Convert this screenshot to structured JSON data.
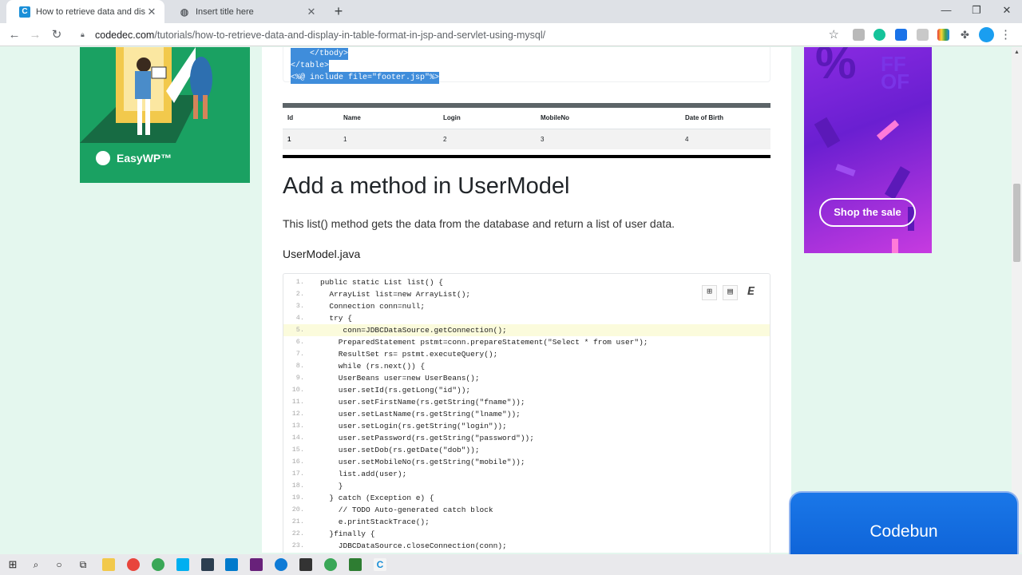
{
  "browser": {
    "tabs": [
      {
        "title": "How to retrieve data and display",
        "active": true,
        "favicon": "C"
      },
      {
        "title": "Insert title here",
        "active": false,
        "favicon": "globe-icon"
      }
    ],
    "url_host": "codedec.com",
    "url_path": "/tutorials/how-to-retrieve-data-and-display-in-table-format-in-jsp-and-servlet-using-mysql/"
  },
  "code_top": [
    "    </tbody>",
    "</table>",
    "<%@ include file=\"footer.jsp\"%>"
  ],
  "example_table": {
    "headers": [
      "Id",
      "Name",
      "Login",
      "MobileNo",
      "Date of Birth"
    ],
    "row": [
      "1",
      "1",
      "2",
      "3",
      "4"
    ]
  },
  "heading": "Add a method in UserModel",
  "paragraph": "This list() method gets the data from the database and return a list of user data.",
  "filename": "UserModel.java",
  "code_lines": [
    {
      "n": "1.",
      "text": "public static List list() {"
    },
    {
      "n": "2.",
      "text": "  ArrayList list=new ArrayList();"
    },
    {
      "n": "3.",
      "text": "  Connection conn=null;"
    },
    {
      "n": "4.",
      "text": "  try {"
    },
    {
      "n": "5.",
      "text": "     conn=JDBCDataSource.getConnection();"
    },
    {
      "n": "6.",
      "text": "    PreparedStatement pstmt=conn.prepareStatement(\"Select * from user\");"
    },
    {
      "n": "7.",
      "text": "    ResultSet rs= pstmt.executeQuery();"
    },
    {
      "n": "8.",
      "text": "    while (rs.next()) {"
    },
    {
      "n": "9.",
      "text": "    UserBeans user=new UserBeans();"
    },
    {
      "n": "10.",
      "text": "    user.setId(rs.getLong(\"id\"));"
    },
    {
      "n": "11.",
      "text": "    user.setFirstName(rs.getString(\"fname\"));"
    },
    {
      "n": "12.",
      "text": "    user.setLastName(rs.getString(\"lname\"));"
    },
    {
      "n": "13.",
      "text": "    user.setLogin(rs.getString(\"login\"));"
    },
    {
      "n": "14.",
      "text": "    user.setPassword(rs.getString(\"password\"));"
    },
    {
      "n": "15.",
      "text": "    user.setDob(rs.getDate(\"dob\"));"
    },
    {
      "n": "16.",
      "text": "    user.setMobileNo(rs.getString(\"mobile\"));"
    },
    {
      "n": "17.",
      "text": "    list.add(user);"
    },
    {
      "n": "18.",
      "text": "    }"
    },
    {
      "n": "19.",
      "text": "  } catch (Exception e) {"
    },
    {
      "n": "20.",
      "text": "    // TODO Auto-generated catch block"
    },
    {
      "n": "21.",
      "text": "    e.printStackTrace();"
    },
    {
      "n": "22.",
      "text": "  }finally {"
    },
    {
      "n": "23.",
      "text": "    JDBCDataSource.closeConnection(conn);"
    }
  ],
  "highlighted_line": 5,
  "ad_left": {
    "brand": "EasyWP™"
  },
  "ad_right": {
    "cta": "Shop the sale",
    "big_text": "%"
  },
  "overlay": {
    "label": "Codebun"
  },
  "colors": {
    "accent": "#1a73e8",
    "selection": "#3f8ddb",
    "page_bg": "#e4f7ee"
  }
}
